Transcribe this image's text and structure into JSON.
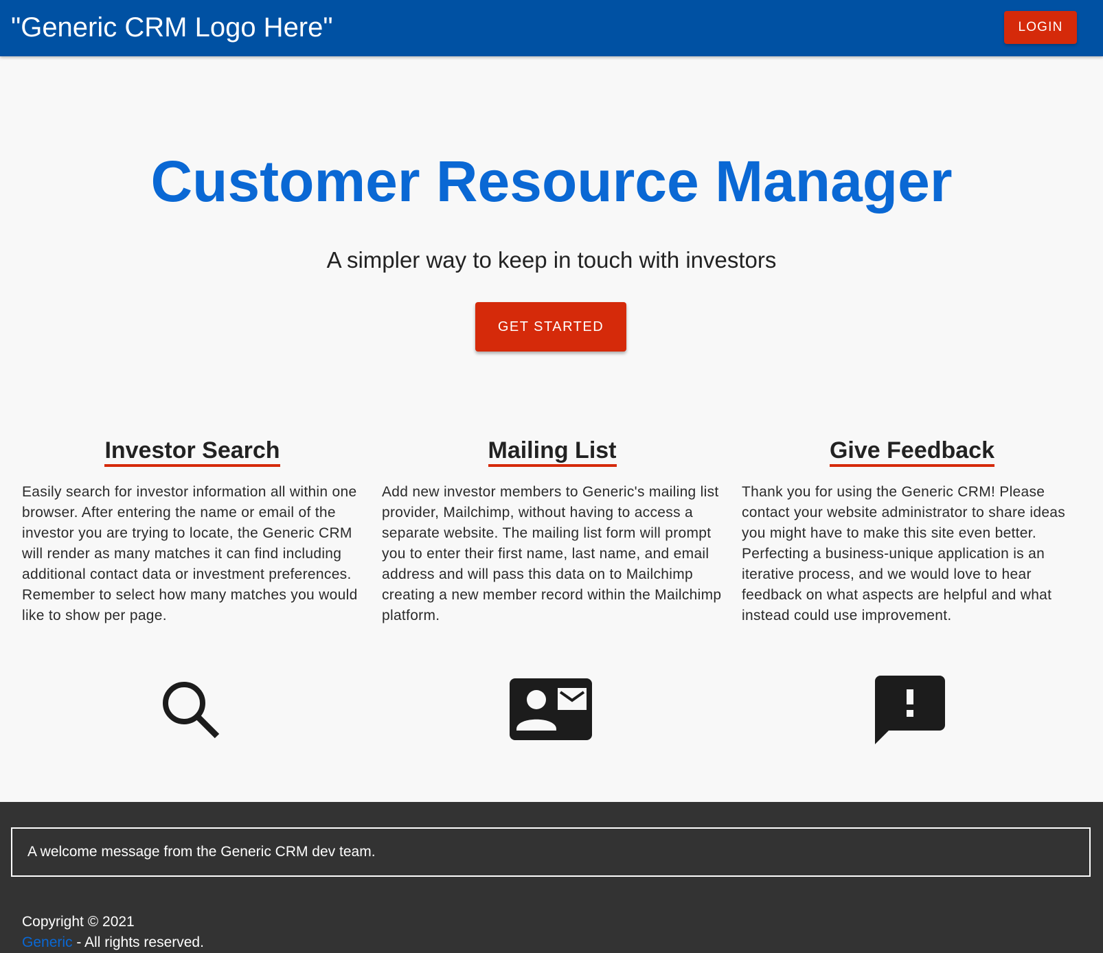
{
  "header": {
    "logo_text": "\"Generic CRM Logo Here\"",
    "login_label": "LOGIN"
  },
  "hero": {
    "title": "Customer Resource Manager",
    "subtitle": "A simpler way to keep in touch with investors",
    "cta_label": "GET STARTED"
  },
  "features": [
    {
      "title": "Investor Search",
      "text": "Easily search for investor information all within one browser. After entering the name or email of the investor you are trying to locate, the Generic CRM will render as many matches it can find including additional contact data or investment preferences. Remember to select how many matches you would like to show per page.",
      "icon": "search-icon"
    },
    {
      "title": "Mailing List",
      "text": "Add new investor members to Generic's mailing list provider, Mailchimp, without having to access a separate website. The mailing list form will prompt you to enter their first name, last name, and email address and will pass this data on to Mailchimp creating a new member record within the Mailchimp platform.",
      "icon": "contact-mail-icon"
    },
    {
      "title": "Give Feedback",
      "text": "Thank you for using the Generic CRM! Please contact your website administrator to share ideas you might have to make this site even better. Perfecting a business-unique application is an iterative process, and we would love to hear feedback on what aspects are helpful and what instead could use improvement.",
      "icon": "feedback-icon"
    }
  ],
  "footer": {
    "welcome_message": "A welcome message from the Generic CRM dev team.",
    "copyright": "Copyright © 2021",
    "company_link": "Generic",
    "rights": " - All rights reserved."
  },
  "colors": {
    "app_bar": "#0051a3",
    "accent_red": "#d52a0a",
    "title_blue": "#0a68d4",
    "footer_bg": "#333333",
    "page_bg": "#f8f8f8"
  }
}
